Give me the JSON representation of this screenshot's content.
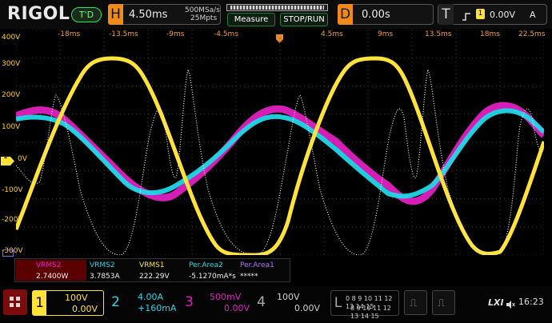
{
  "header": {
    "logo": "RIGOL",
    "trigger_status": "T'D",
    "horizontal": {
      "label": "H",
      "timebase": "4.50ms",
      "sample_rate": "500MSa/s",
      "memory_depth": "25Mpts"
    },
    "measure_label": "Measure",
    "stop_run_label": "STOP/RUN",
    "delay": {
      "label": "D",
      "value": "0.00s"
    },
    "trigger": {
      "label": "T",
      "level": "0.00V",
      "mode": "A",
      "slope_icon": "rising-edge-icon"
    }
  },
  "time_axis": [
    "-18ms",
    "-13.5ms",
    "-9ms",
    "-4.5ms",
    "4.5ms",
    "9ms",
    "13.5ms",
    "18ms",
    "22.5ms"
  ],
  "volt_axis": [
    "400V",
    "300V",
    "200V",
    "100V",
    "0V",
    "-100V",
    "-200V",
    "-300V"
  ],
  "trace_markers": {
    "ch1": "1"
  },
  "measurements": [
    {
      "label": "VRMS2",
      "value": "2.7400W",
      "color": "#e020c0",
      "highlight": true
    },
    {
      "label": "VRMS2",
      "value": "3.7853A",
      "color": "#20d8e8",
      "highlight": false
    },
    {
      "label": "VRMS1",
      "value": "222.29V",
      "color": "#ffe23a",
      "highlight": false
    },
    {
      "label": "Per.Area2",
      "value": "-5.1270mA*s",
      "color": "#20d8e8",
      "highlight": false
    },
    {
      "label": "Per.Area1",
      "value": "*****",
      "color": "#b070ff",
      "highlight": false
    }
  ],
  "channels": [
    {
      "num": "1",
      "scale": "100V",
      "offset": "0.00V",
      "color": "#ffe23a"
    },
    {
      "num": "2",
      "scale": "4.00A",
      "offset": "+160mA",
      "color": "#20d8e8"
    },
    {
      "num": "3",
      "scale": "500mV",
      "offset": "0.00V",
      "color": "#e020c0"
    },
    {
      "num": "4",
      "scale": "100V",
      "offset": "0.00V",
      "color": "#aaaaaa"
    }
  ],
  "logic": {
    "label": "L",
    "row1": "0 8 9 10 11 12 13 14 15",
    "row2": "8 9 10 11 12 13 14 15"
  },
  "bottom_right": {
    "lxi": "LXI",
    "time": "16:23"
  },
  "colors": {
    "ch1": "#ffe23a",
    "ch2": "#20d8e8",
    "ch3": "#e020c0",
    "accent": "#f08a1a"
  }
}
